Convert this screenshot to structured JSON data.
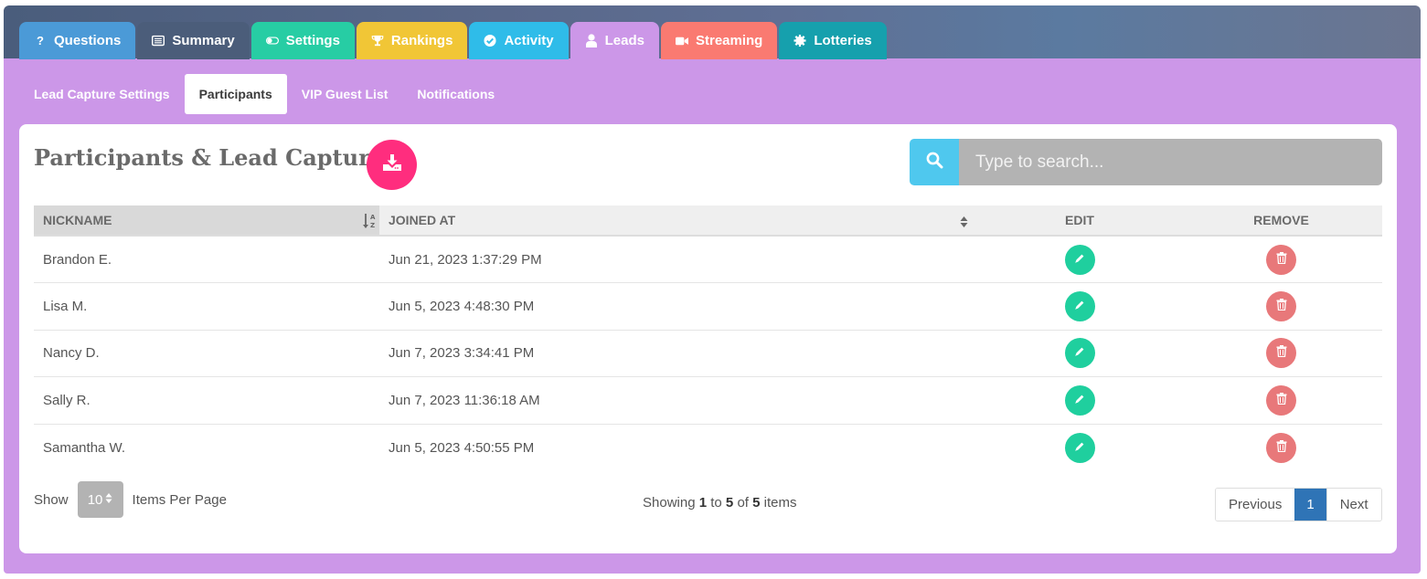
{
  "tabs": [
    {
      "label": "Questions",
      "icon": "question-icon",
      "color": "#4b9ad7"
    },
    {
      "label": "Summary",
      "icon": "list-icon",
      "color": "#4b5d7a"
    },
    {
      "label": "Settings",
      "icon": "toggle-icon",
      "color": "#27cda4"
    },
    {
      "label": "Rankings",
      "icon": "trophy-icon",
      "color": "#f1c636"
    },
    {
      "label": "Activity",
      "icon": "check-circle-icon",
      "color": "#2fbce9"
    },
    {
      "label": "Leads",
      "icon": "user-icon",
      "color": "#cc97e8"
    },
    {
      "label": "Streaming",
      "icon": "video-icon",
      "color": "#fa7a71"
    },
    {
      "label": "Lotteries",
      "icon": "gear-icon",
      "color": "#16a0ad"
    }
  ],
  "subnav": [
    "Lead Capture Settings",
    "Participants",
    "VIP Guest List",
    "Notifications"
  ],
  "page_title": "Participants & Lead Capture",
  "search": {
    "placeholder": "Type to search..."
  },
  "table": {
    "headers": {
      "nickname": "NICKNAME",
      "joined": "JOINED AT",
      "edit": "EDIT",
      "remove": "REMOVE"
    },
    "rows": [
      {
        "nickname": "Brandon E.",
        "joined": "Jun 21, 2023 1:37:29 PM"
      },
      {
        "nickname": "Lisa M.",
        "joined": "Jun 5, 2023 4:48:30 PM"
      },
      {
        "nickname": "Nancy D.",
        "joined": "Jun 7, 2023 3:34:41 PM"
      },
      {
        "nickname": "Sally R.",
        "joined": "Jun 7, 2023 11:36:18 AM"
      },
      {
        "nickname": "Samantha W.",
        "joined": "Jun 5, 2023 4:50:55 PM"
      }
    ]
  },
  "footer": {
    "show_label": "Show",
    "per_page": "10",
    "items_per_page_label": "Items Per Page",
    "showing_prefix": "Showing",
    "from": "1",
    "to_word": "to",
    "to": "5",
    "of_word": "of",
    "total": "5",
    "items_word": "items",
    "previous": "Previous",
    "current_page": "1",
    "next": "Next"
  }
}
